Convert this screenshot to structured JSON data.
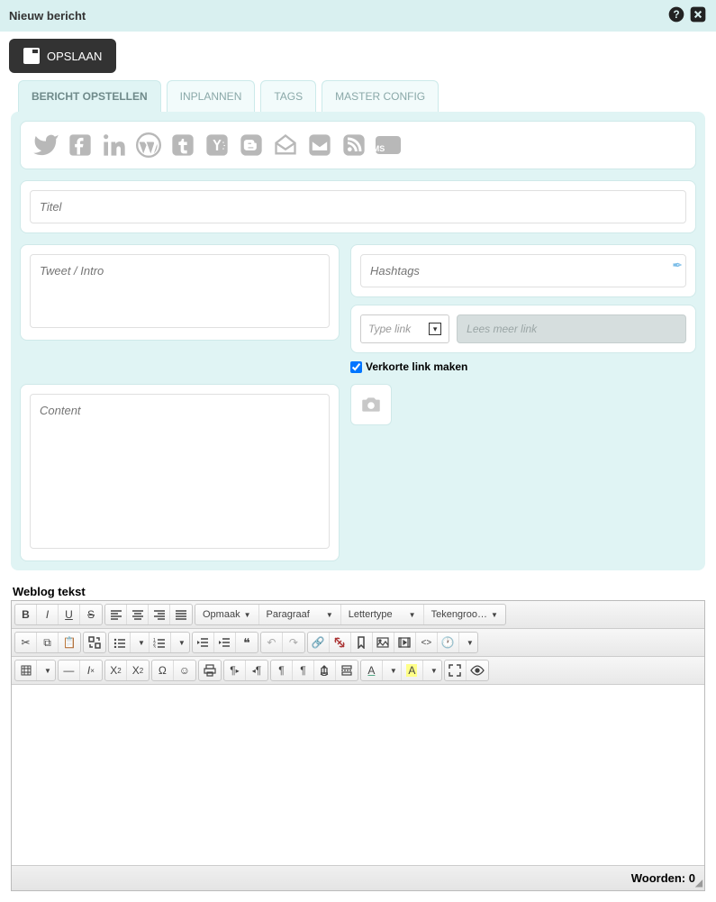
{
  "header": {
    "title": "Nieuw bericht"
  },
  "actions": {
    "save": "OPSLAAN"
  },
  "tabs": {
    "compose": "BERICHT OPSTELLEN",
    "schedule": "INPLANNEN",
    "tags": "TAGS",
    "master": "MASTER CONFIG"
  },
  "fields": {
    "title_ph": "Titel",
    "tweet_ph": "Tweet / Intro",
    "hashtags_ph": "Hashtags",
    "typelink_ph": "Type link",
    "readmore_ph": "Lees meer link",
    "shortlink_label": "Verkorte link maken",
    "content_ph": "Content"
  },
  "weblog": {
    "label": "Weblog tekst"
  },
  "editor": {
    "format": "Opmaak",
    "paragraph": "Paragraaf",
    "font": "Lettertype",
    "fontsize": "Tekengroo…",
    "wordcount_label": "Woorden:",
    "wordcount_value": "0"
  },
  "social": {
    "sms": "SMS"
  }
}
